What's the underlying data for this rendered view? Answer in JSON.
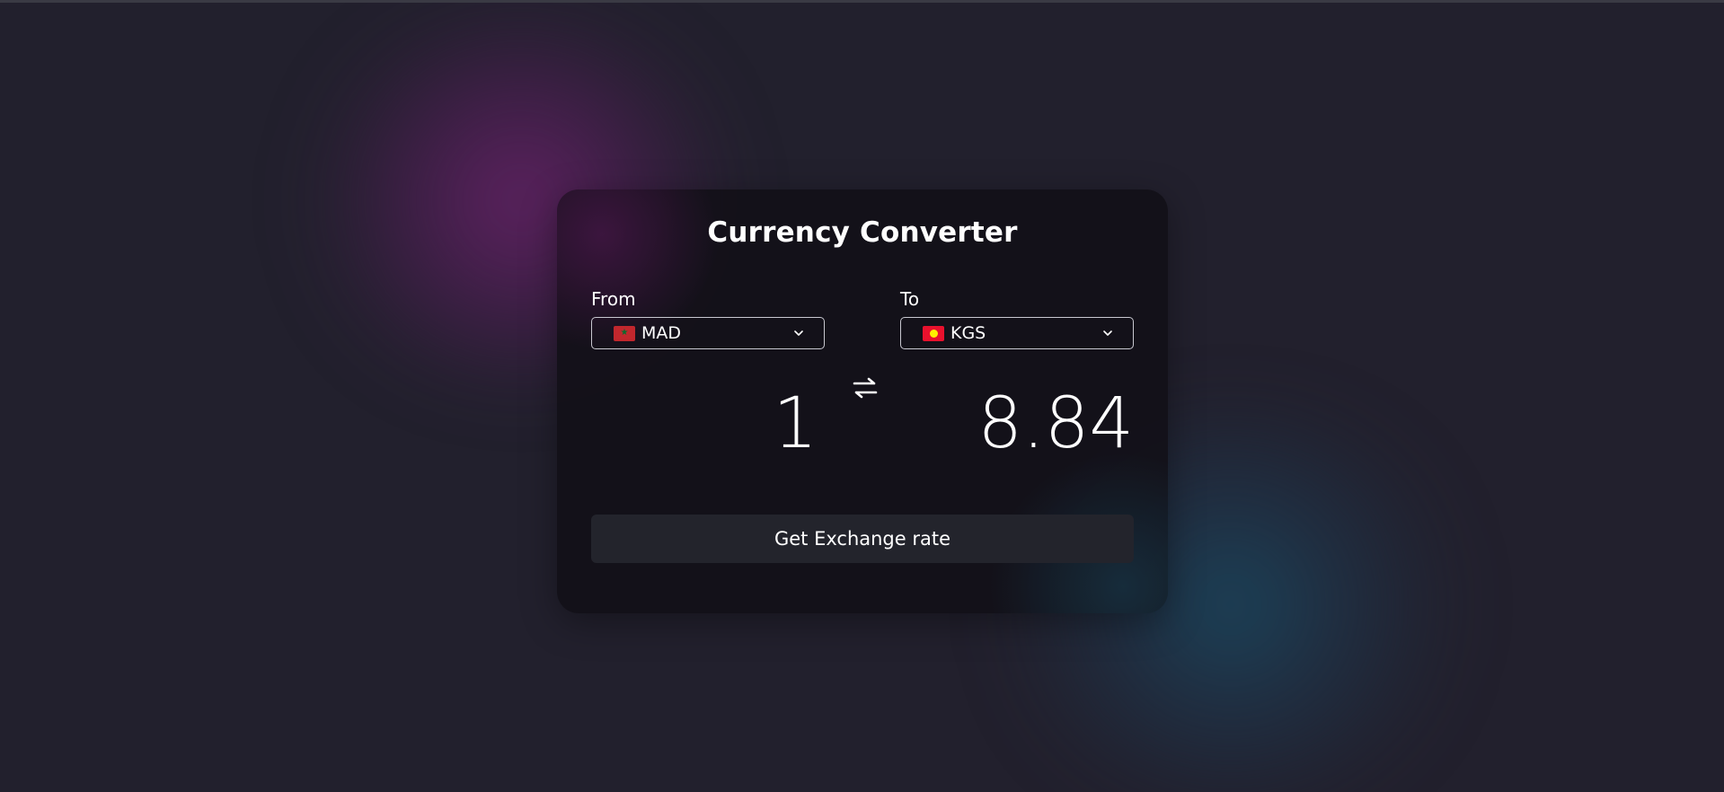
{
  "app": {
    "title": "Currency Converter"
  },
  "from": {
    "label": "From",
    "currency": "MAD",
    "flag_icon": "morocco-flag-icon",
    "amount": "1"
  },
  "to": {
    "label": "To",
    "currency": "KGS",
    "flag_icon": "kyrgyzstan-flag-icon",
    "amount": "8.84"
  },
  "swap_icon": "swap-arrows-icon",
  "action": {
    "label": "Get Exchange rate"
  },
  "colors": {
    "background": "#22202d",
    "card": "#121018",
    "button": "#23242c",
    "text": "#ffffff",
    "glow_purple": "#6e236e",
    "glow_teal": "#194b64"
  }
}
